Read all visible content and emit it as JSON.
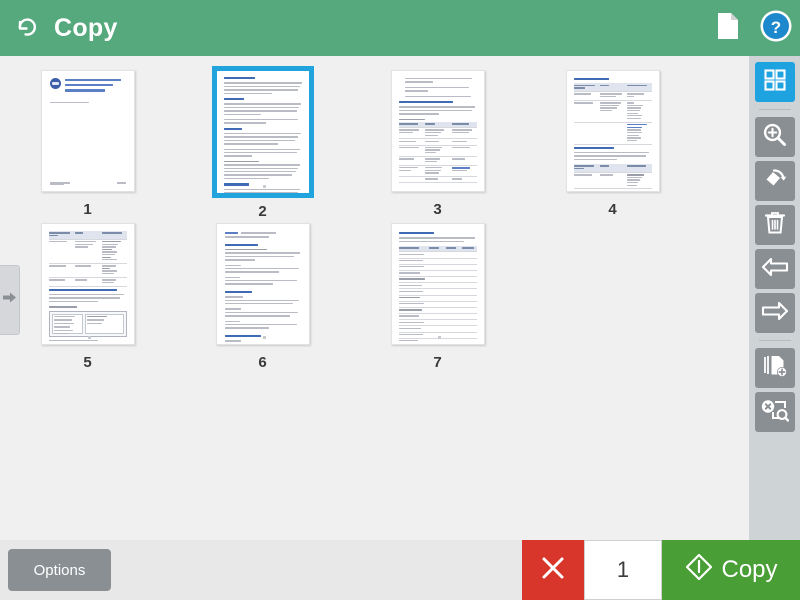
{
  "header": {
    "title": "Copy",
    "back_icon": "back-arrow-icon",
    "document_icon": "document-page-icon",
    "help_icon": "help-question-icon",
    "bg_color": "#55a97c"
  },
  "main": {
    "bg_color": "#f0f0f0",
    "selected_page": 2,
    "pages": [
      {
        "number": "1",
        "kind": "title-page"
      },
      {
        "number": "2",
        "kind": "text-page"
      },
      {
        "number": "3",
        "kind": "list-table-page"
      },
      {
        "number": "4",
        "kind": "tables-page"
      },
      {
        "number": "5",
        "kind": "table-figure-page"
      },
      {
        "number": "6",
        "kind": "sections-page"
      },
      {
        "number": "7",
        "kind": "big-table-page"
      }
    ]
  },
  "edge_tab": {
    "icon": "arrow-right-icon",
    "label": ""
  },
  "toolbar": {
    "items": [
      {
        "name": "grid-view-button",
        "icon": "grid-view-icon",
        "active": true
      },
      {
        "name": "zoom-in-button",
        "icon": "magnifier-plus-icon",
        "active": false
      },
      {
        "name": "rotate-page-button",
        "icon": "rotate-page-icon",
        "active": false
      },
      {
        "name": "delete-page-button",
        "icon": "trash-icon",
        "active": false
      },
      {
        "name": "move-left-button",
        "icon": "arrow-left-icon",
        "active": false
      },
      {
        "name": "move-right-button",
        "icon": "arrow-right-icon",
        "active": false
      },
      {
        "name": "add-pages-button",
        "icon": "add-pages-icon",
        "active": false
      },
      {
        "name": "blank-page-detect-button",
        "icon": "blank-page-detect-icon",
        "active": false
      }
    ],
    "active_color": "#1ea2e0",
    "button_color": "#8a8f94"
  },
  "bottom": {
    "options_label": "Options",
    "cancel_icon": "close-x-icon",
    "cancel_color": "#d8362a",
    "copies_value": "1",
    "copy_label": "Copy",
    "copy_icon": "start-diamond-icon",
    "copy_color": "#4a9e36"
  }
}
